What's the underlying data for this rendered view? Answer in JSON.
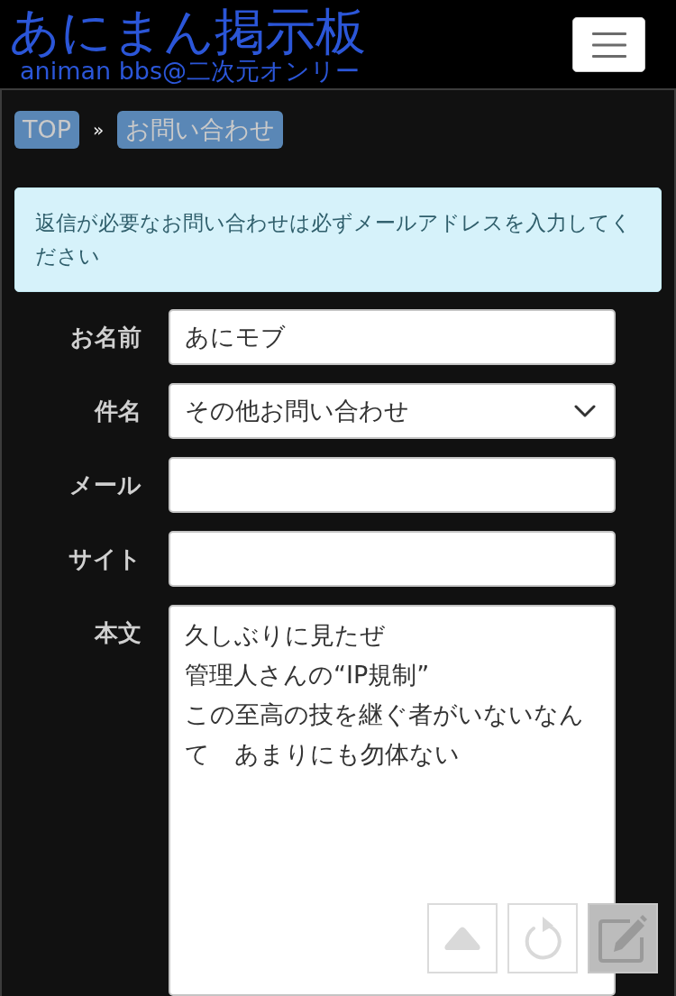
{
  "header": {
    "title": "あにまん掲示板",
    "subtitle": "animan bbs@二次元オンリー"
  },
  "breadcrumb": {
    "items": [
      {
        "label": "TOP"
      },
      {
        "label": "お問い合わせ"
      }
    ],
    "separator": "»"
  },
  "notice": "返信が必要なお問い合わせは必ずメールアドレスを入力してください",
  "form": {
    "fields": [
      {
        "kind": "text",
        "label": "お名前",
        "value": "あにモブ"
      },
      {
        "kind": "select",
        "label": "件名",
        "value": "その他お問い合わせ"
      },
      {
        "kind": "text",
        "label": "メール"
      },
      {
        "kind": "text",
        "label": "サイト"
      },
      {
        "kind": "textarea",
        "label": "本文",
        "lines": [
          "久しぶりに見たぜ",
          "管理人さんの“IP規制”",
          "この至高の技を継ぐ者がいないなんて　あまりにも勿体ない"
        ]
      }
    ]
  },
  "floating_buttons": [
    {
      "kind": "top"
    },
    {
      "kind": "reload"
    },
    {
      "kind": "edit"
    }
  ]
}
